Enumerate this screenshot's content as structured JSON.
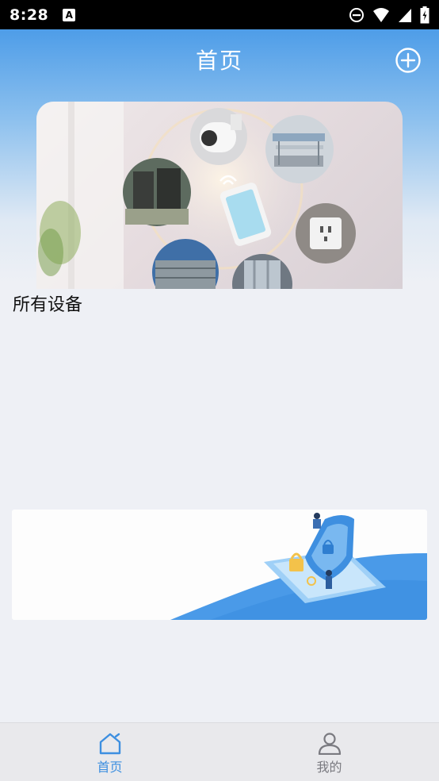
{
  "status_bar": {
    "time": "8:28",
    "notification_icon": "A",
    "icons": [
      "dnd-icon",
      "wifi-icon",
      "signal-icon",
      "battery-icon"
    ]
  },
  "header": {
    "title": "首页",
    "add_icon": "plus-circle-icon"
  },
  "banner": {
    "icons": [
      "camera-icon",
      "gate-icon",
      "phone-icon",
      "clothes-rack-icon",
      "socket-icon",
      "garage-door-icon",
      "curtain-icon"
    ]
  },
  "devices_section": {
    "title": "所有设备"
  },
  "promo": {
    "icon": "security-shield-illustration"
  },
  "bottom_nav": {
    "items": [
      {
        "label": "首页",
        "icon": "home-icon",
        "active": true
      },
      {
        "label": "我的",
        "icon": "user-icon",
        "active": false
      }
    ]
  },
  "colors": {
    "accent": "#3d8fe0",
    "header_top": "#4e9de8",
    "page_bg": "#eef0f5",
    "nav_inactive": "#7a7a80"
  }
}
